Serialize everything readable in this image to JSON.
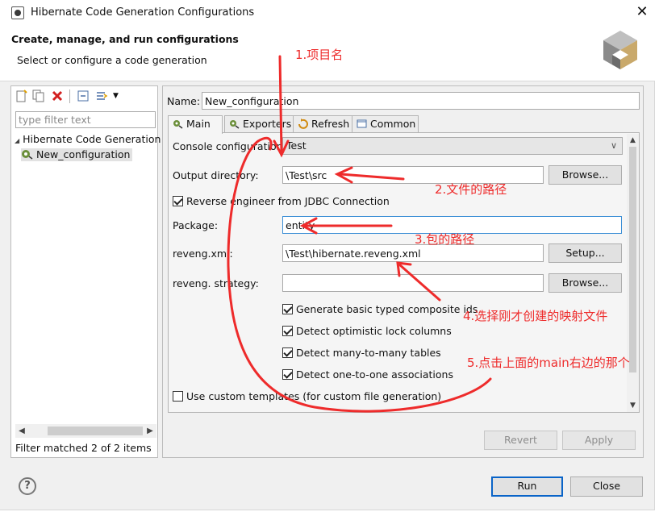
{
  "window": {
    "title": "Hibernate Code Generation Configurations",
    "close": "✕"
  },
  "header": {
    "title": "Create, manage, and run configurations",
    "subtitle": "Select or configure a code generation"
  },
  "left": {
    "filter_placeholder": "type filter text",
    "tree": [
      {
        "label": "Hibernate Code Generation"
      },
      {
        "label": "New_configuration"
      }
    ],
    "status": "Filter matched 2 of 2 items"
  },
  "form": {
    "name_label": "Name:",
    "name_value": "New_configuration",
    "tabs": [
      {
        "label": "Main"
      },
      {
        "label": "Exporters"
      },
      {
        "label": "Refresh"
      },
      {
        "label": "Common"
      }
    ],
    "console_label": "Console configuration:",
    "console_value": "Test",
    "output_label": "Output directory:",
    "output_value": "\\Test\\src",
    "browse_label": "Browse...",
    "reverse_label": "Reverse engineer from JDBC Connection",
    "package_label": "Package:",
    "package_value": "entity",
    "reveng_label": "reveng.xml:",
    "reveng_value": "\\Test\\hibernate.reveng.xml",
    "setup_label": "Setup...",
    "strategy_label": "reveng. strategy:",
    "strategy_value": "",
    "browse2_label": "Browse...",
    "checks": [
      {
        "label": "Generate basic typed composite ids",
        "checked": true
      },
      {
        "label": "Detect optimistic lock columns",
        "checked": true
      },
      {
        "label": "Detect many-to-many tables",
        "checked": true
      },
      {
        "label": "Detect one-to-one associations",
        "checked": true
      }
    ],
    "templates_label": "Use custom templates (for custom file generation)",
    "revert_label": "Revert",
    "apply_label": "Apply"
  },
  "footer": {
    "help": "?",
    "run_label": "Run",
    "close_label": "Close"
  },
  "annotations": [
    {
      "text": "1.项目名"
    },
    {
      "text": "2.文件的路径"
    },
    {
      "text": "3.包的路径"
    },
    {
      "text": "4.选择刚才创建的映射文件"
    },
    {
      "text": "5.点击上面的main右边的那个"
    }
  ],
  "colors": {
    "annotation_red": "#ee2b2b",
    "focus_blue": "#3c8fd6",
    "primary_border": "#0a64c8"
  }
}
